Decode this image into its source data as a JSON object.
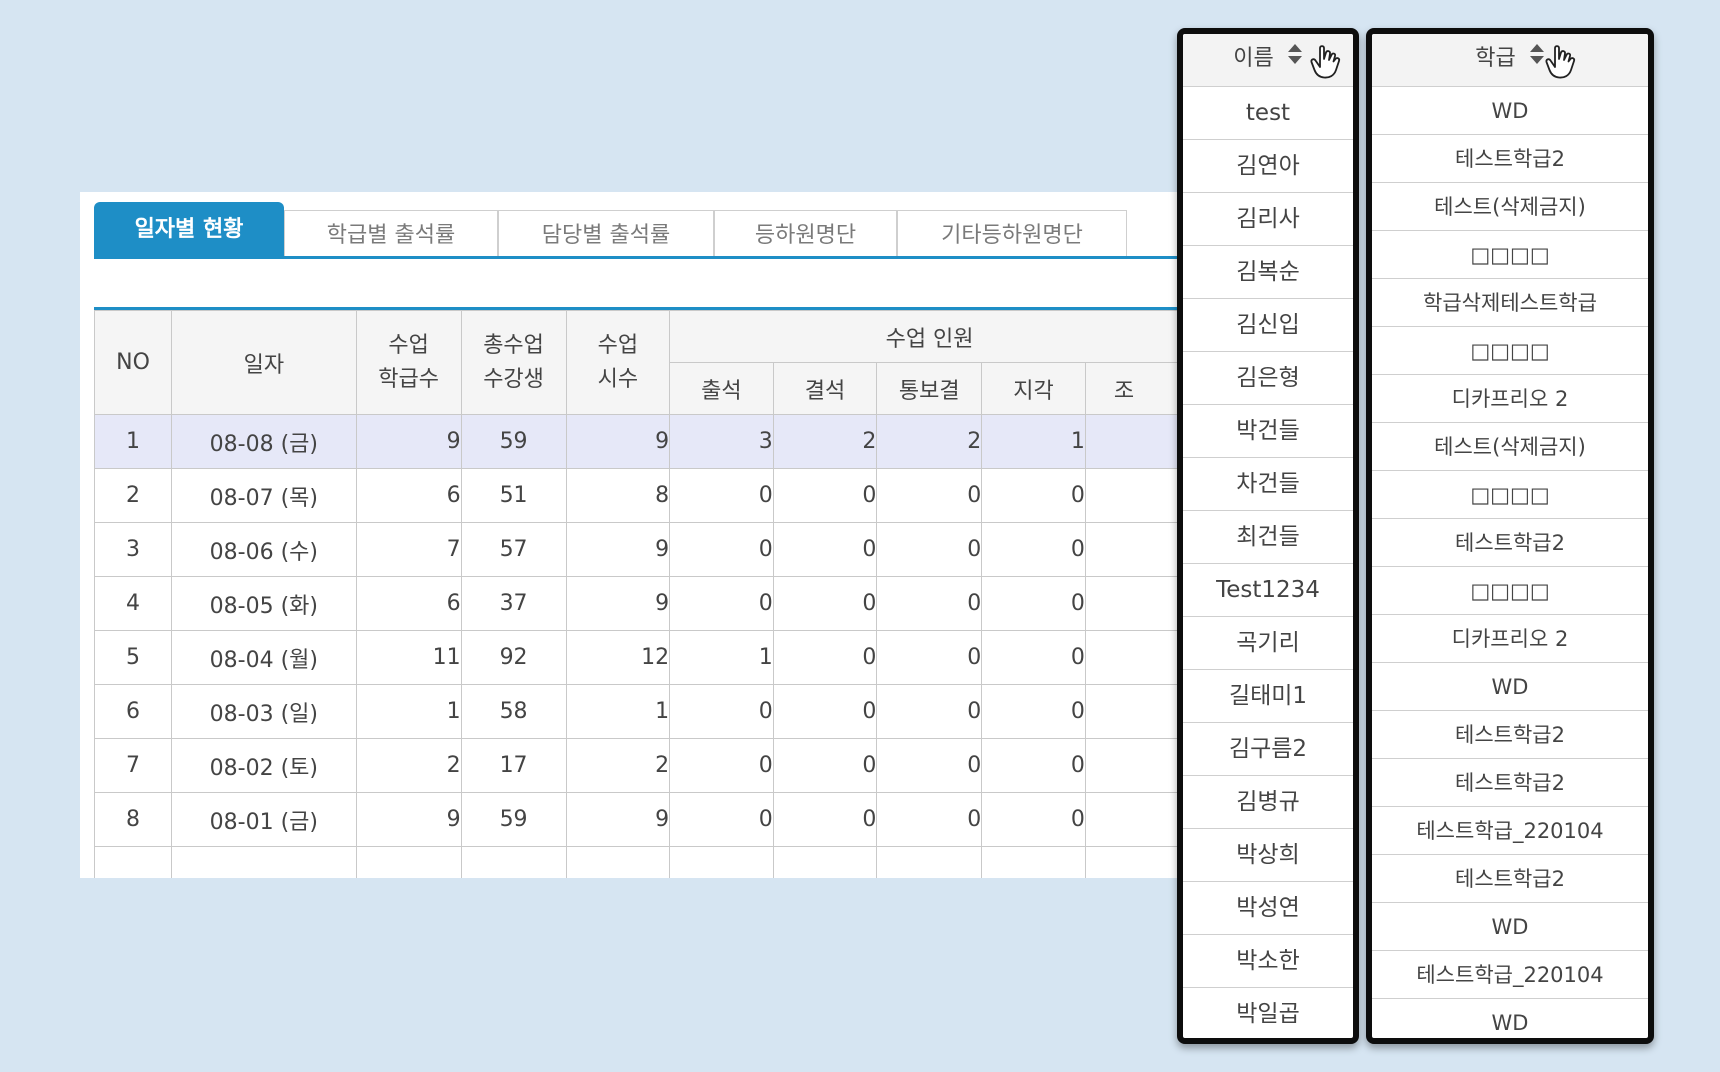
{
  "tabs": [
    {
      "label": "일자별 현황",
      "active": true
    },
    {
      "label": "학급별 출석률",
      "active": false
    },
    {
      "label": "담당별 출석률",
      "active": false
    },
    {
      "label": "등하원명단",
      "active": false
    },
    {
      "label": "기타등하원명단",
      "active": false
    }
  ],
  "table": {
    "headers": {
      "no": "NO",
      "date": "일자",
      "class_count_1": "수업",
      "class_count_2": "학급수",
      "students_1": "총수업",
      "students_2": "수강생",
      "hours_1": "수업",
      "hours_2": "시수",
      "group": "수업 인원",
      "attend": "출석",
      "absent": "결석",
      "notified": "통보결",
      "late": "지각",
      "early_partial": "조"
    },
    "rows": [
      {
        "no": "1",
        "date": "08-08 (금)",
        "classes": "9",
        "students": "59",
        "hours": "9",
        "attend": "3",
        "absent": "2",
        "notified": "2",
        "late": "1",
        "highlighted": true
      },
      {
        "no": "2",
        "date": "08-07 (목)",
        "classes": "6",
        "students": "51",
        "hours": "8",
        "attend": "0",
        "absent": "0",
        "notified": "0",
        "late": "0"
      },
      {
        "no": "3",
        "date": "08-06 (수)",
        "classes": "7",
        "students": "57",
        "hours": "9",
        "attend": "0",
        "absent": "0",
        "notified": "0",
        "late": "0"
      },
      {
        "no": "4",
        "date": "08-05 (화)",
        "classes": "6",
        "students": "37",
        "hours": "9",
        "attend": "0",
        "absent": "0",
        "notified": "0",
        "late": "0"
      },
      {
        "no": "5",
        "date": "08-04 (월)",
        "classes": "11",
        "students": "92",
        "hours": "12",
        "attend": "1",
        "absent": "0",
        "notified": "0",
        "late": "0"
      },
      {
        "no": "6",
        "date": "08-03 (일)",
        "classes": "1",
        "students": "58",
        "hours": "1",
        "attend": "0",
        "absent": "0",
        "notified": "0",
        "late": "0"
      },
      {
        "no": "7",
        "date": "08-02 (토)",
        "classes": "2",
        "students": "17",
        "hours": "2",
        "attend": "0",
        "absent": "0",
        "notified": "0",
        "late": "0"
      },
      {
        "no": "8",
        "date": "08-01 (금)",
        "classes": "9",
        "students": "59",
        "hours": "9",
        "attend": "0",
        "absent": "0",
        "notified": "0",
        "late": "0"
      }
    ]
  },
  "name_column": {
    "header": "이름",
    "sort_icon": "sort-updown-icon",
    "cursor_icon": "hand-pointer-icon",
    "items": [
      "test",
      "김연아",
      "김리사",
      "김복순",
      "김신입",
      "김은형",
      "박건들",
      "차건들",
      "최건들",
      "Test1234",
      "곡기리",
      "길태미1",
      "김구름2",
      "김병규",
      "박상희",
      "박성연",
      "박소한",
      "박일곱"
    ]
  },
  "class_column": {
    "header": "학급",
    "sort_icon": "sort-updown-icon",
    "cursor_icon": "hand-pointer-icon",
    "items": [
      "WD",
      "테스트학급2",
      "테스트(삭제금지)",
      "□□□□",
      "학급삭제테스트학급",
      "□□□□",
      "디카프리오 2",
      "테스트(삭제금지)",
      "□□□□",
      "테스트학급2",
      "□□□□",
      "디카프리오 2",
      "WD",
      "테스트학급2",
      "테스트학급2",
      "테스트학급_220104",
      "테스트학급2",
      "WD",
      "테스트학급_220104",
      "WD"
    ]
  },
  "colors": {
    "background": "#d6e5f2",
    "accent": "#1e8ec6",
    "row_highlight": "#e6e8f8",
    "popup_border": "#0d0d0d"
  }
}
